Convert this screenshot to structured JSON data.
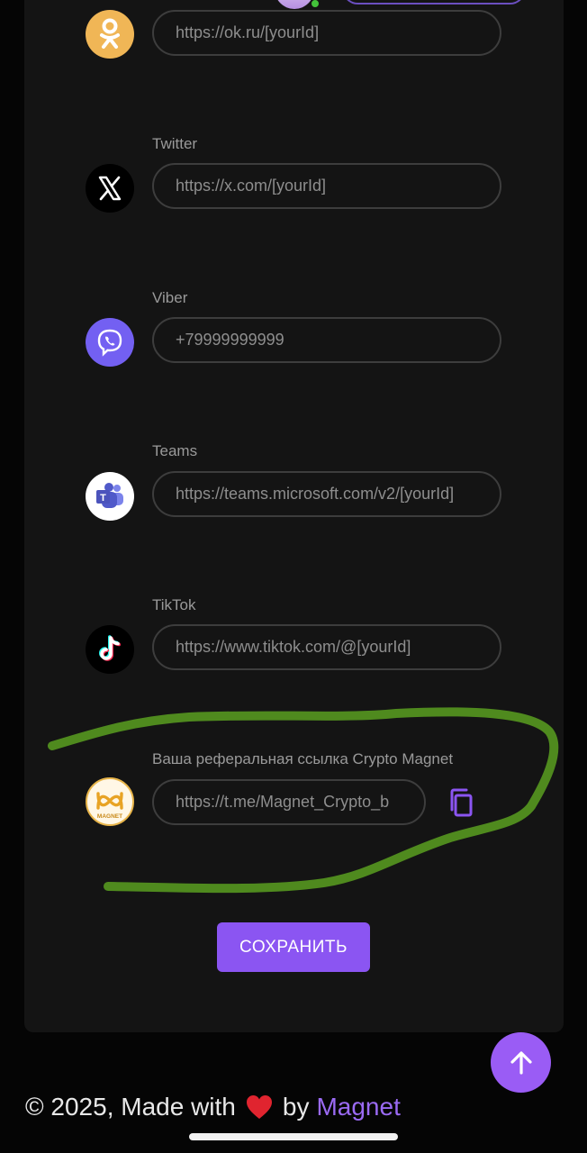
{
  "socials": [
    {
      "key": "ok",
      "label": "",
      "value": "https://ok.ru/[yourId]",
      "icon": "odnoklassniki-icon",
      "color": "#f0b656"
    },
    {
      "key": "twitter",
      "label": "Twitter",
      "value": "https://x.com/[yourId]",
      "icon": "x-logo-icon",
      "color": "#000000"
    },
    {
      "key": "viber",
      "label": "Viber",
      "value": "+79999999999",
      "icon": "viber-icon",
      "color": "#7360f2"
    },
    {
      "key": "teams",
      "label": "Teams",
      "value": "https://teams.microsoft.com/v2/[yourId]",
      "icon": "teams-icon",
      "color": "#ffffff"
    },
    {
      "key": "tiktok",
      "label": "TikTok",
      "value": "https://www.tiktok.com/@[yourId]",
      "icon": "tiktok-icon",
      "color": "#000000"
    }
  ],
  "referral": {
    "label": "Ваша реферальная ссылка Crypto Magnet",
    "value": "https://t.me/Magnet_Crypto_b",
    "icon": "magnet-logo-icon",
    "logo_text": "MAGNET",
    "copy_icon": "copy-icon"
  },
  "save_button": "СОХРАНИТЬ",
  "scroll_top_icon": "arrow-up-icon",
  "footer": {
    "prefix": "© 2025, Made with",
    "by": "by",
    "brand": "Magnet",
    "heart_icon": "heart-icon"
  },
  "colors": {
    "accent": "#8b55f2",
    "brand_link": "#9a6af3",
    "annotation": "#4f8a1e",
    "card_bg": "#141414"
  }
}
